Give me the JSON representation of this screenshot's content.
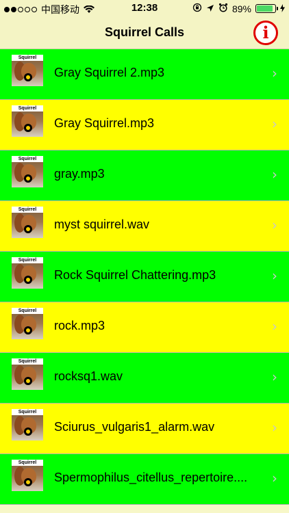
{
  "status_bar": {
    "carrier": "中国移动",
    "time": "12:38",
    "battery": "89%",
    "battery_level": 0.89,
    "signal_bars_filled": 2,
    "signal_bars_total": 5
  },
  "navbar": {
    "title": "Squirrel Calls",
    "info_button": "i"
  },
  "thumbnail_label": "Squirrel",
  "chevron": "›",
  "rows": [
    {
      "label": "Gray Squirrel 2.mp3",
      "color": "#00ff00"
    },
    {
      "label": "Gray Squirrel.mp3",
      "color": "#ffff00"
    },
    {
      "label": "gray.mp3",
      "color": "#00ff00"
    },
    {
      "label": "myst squirrel.wav",
      "color": "#ffff00"
    },
    {
      "label": "Rock Squirrel Chattering.mp3",
      "color": "#00ff00"
    },
    {
      "label": "rock.mp3",
      "color": "#ffff00"
    },
    {
      "label": "rocksq1.wav",
      "color": "#00ff00"
    },
    {
      "label": "Sciurus_vulgaris1_alarm.wav",
      "color": "#ffff00"
    },
    {
      "label": "Spermophilus_citellus_repertoire....",
      "color": "#00ff00"
    }
  ],
  "colors": {
    "accent_red": "#e00000",
    "row_green": "#00ff00",
    "row_yellow": "#ffff00"
  }
}
